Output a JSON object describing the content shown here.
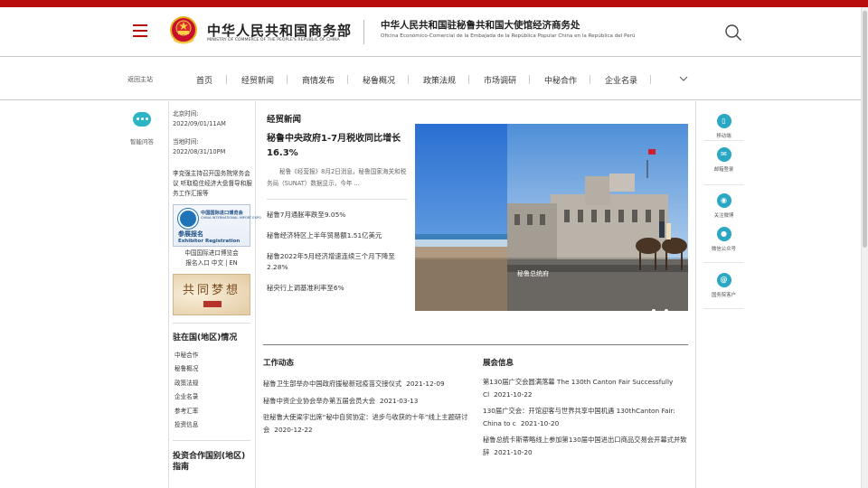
{
  "header": {
    "mofcom_cn": "中华人民共和国商务部",
    "mofcom_en": "MINISTRY OF COMMERCE OF THE PEOPLE'S REPUBLIC OF CHINA",
    "office_cn": "中华人民共和国驻秘鲁共和国大使馆经济商务处",
    "office_es": "Oficina Económico-Comercial de la Embajada de la República Popular China en la República del Perú",
    "menu_icon": "hamburger-menu-icon",
    "search_icon": "search-icon",
    "accent_color": "#b70c0c"
  },
  "nav": {
    "home": "返回主站",
    "items": [
      "首页",
      "经贸新闻",
      "商情发布",
      "秘鲁概况",
      "政策法规",
      "市场调研",
      "中秘合作",
      "企业名录"
    ],
    "more_icon": "chevron-down-icon"
  },
  "left_tool": {
    "label": "智能问答",
    "icon": "chat-bubble-icon"
  },
  "left_col": {
    "beijing_label": "北京时间:",
    "beijing_time": "2022/09/01/11AM",
    "local_label": "当地时间:",
    "local_time": "2022/08/31/10PM",
    "headline": "李克强主持召开国务院常务会议 听取稳住经济大盘督导和服务工作汇报等",
    "expo_banner": {
      "name_cn": "中国国际进口博览会",
      "name_en": "CHINA INTERNATIONAL IMPORT EXPO",
      "signup_cn": "参展报名",
      "signup_en": "Exhibitor Registration"
    },
    "expo_caption_1": "中国国际进口博览会",
    "expo_caption_2": "报名入口",
    "expo_caption_zh": "中文",
    "expo_caption_sep": " | ",
    "expo_caption_en": "EN",
    "dream_banner": "共同梦想",
    "country_title": "驻在国(地区)情况",
    "country_links": [
      "中秘合作",
      "秘鲁概况",
      "政策法规",
      "企业名录",
      "参考汇率",
      "投资信息"
    ],
    "guide_title": "投资合作国别(地区)指南"
  },
  "news": {
    "heading": "经贸新闻",
    "lead_title": "秘鲁中央政府1-7月税收同比增长16.3%",
    "lead_summary": "秘鲁《经营报》8月2日消息，秘鲁国家海关和税务局（SUNAT）数据显示，今年 ...",
    "items": [
      "秘鲁7月通胀率跌至9.05%",
      "秘鲁经济特区上半年贸易额1.51亿美元",
      "秘鲁2022年5月经济增速连续三个月下降至2.28%",
      "秘央行上调基准利率至6%"
    ]
  },
  "carousel": {
    "caption": "秘鲁总统府",
    "slide_count": 3,
    "active_slide": 3
  },
  "work": {
    "title": "工作动态",
    "items": [
      {
        "text": "秘鲁卫生部举办中国政府援秘新冠疫苗交接仪式",
        "date": "2021-12-09"
      },
      {
        "text": "秘鲁中资企业协会举办第五届会员大会",
        "date": "2021-03-13"
      },
      {
        "text": "驻秘鲁大使梁宇出席“秘中自贸协定：进步与收获的十年”线上主题研讨会",
        "date": "2020-12-22"
      }
    ]
  },
  "expo": {
    "title": "展会信息",
    "items": [
      {
        "text": "第130届广交会圆满落幕 The 130th Canton Fair Successfully Cl",
        "date": "2021-10-22"
      },
      {
        "text": "130届广交会：开馆迎客与世界共享中国机遇 130thCanton Fair: China to c",
        "date": "2021-10-20"
      },
      {
        "text": "秘鲁总统卡斯蒂略线上参加第130届中国进出口商品交易会开幕式并致辞",
        "date": "2021-10-20"
      }
    ]
  },
  "share": [
    {
      "label": "移动端",
      "icon": "mobile-icon"
    },
    {
      "label": "邮箱登录",
      "icon": "mail-icon"
    },
    {
      "label": "关注微博",
      "icon": "weibo-icon"
    },
    {
      "label": "微信公众号",
      "icon": "wechat-icon"
    },
    {
      "label": "国务院客户",
      "icon": "at-icon"
    }
  ]
}
